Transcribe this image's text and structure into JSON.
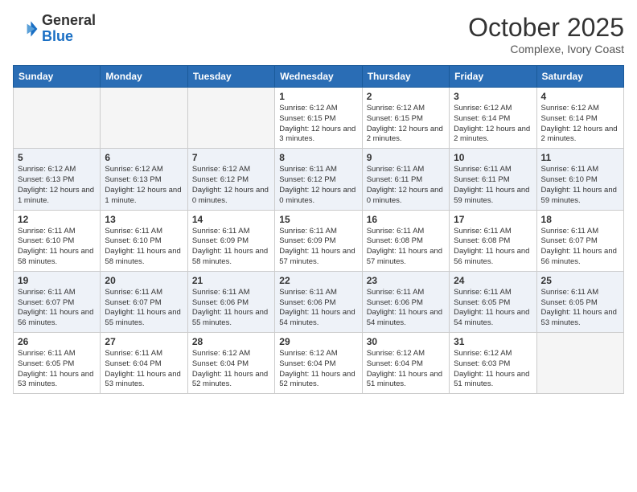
{
  "logo": {
    "general": "General",
    "blue": "Blue"
  },
  "header": {
    "month": "October 2025",
    "location": "Complexe, Ivory Coast"
  },
  "weekdays": [
    "Sunday",
    "Monday",
    "Tuesday",
    "Wednesday",
    "Thursday",
    "Friday",
    "Saturday"
  ],
  "weeks": [
    [
      {
        "day": "",
        "info": ""
      },
      {
        "day": "",
        "info": ""
      },
      {
        "day": "",
        "info": ""
      },
      {
        "day": "1",
        "info": "Sunrise: 6:12 AM\nSunset: 6:15 PM\nDaylight: 12 hours and 3 minutes."
      },
      {
        "day": "2",
        "info": "Sunrise: 6:12 AM\nSunset: 6:15 PM\nDaylight: 12 hours and 2 minutes."
      },
      {
        "day": "3",
        "info": "Sunrise: 6:12 AM\nSunset: 6:14 PM\nDaylight: 12 hours and 2 minutes."
      },
      {
        "day": "4",
        "info": "Sunrise: 6:12 AM\nSunset: 6:14 PM\nDaylight: 12 hours and 2 minutes."
      }
    ],
    [
      {
        "day": "5",
        "info": "Sunrise: 6:12 AM\nSunset: 6:13 PM\nDaylight: 12 hours and 1 minute."
      },
      {
        "day": "6",
        "info": "Sunrise: 6:12 AM\nSunset: 6:13 PM\nDaylight: 12 hours and 1 minute."
      },
      {
        "day": "7",
        "info": "Sunrise: 6:12 AM\nSunset: 6:12 PM\nDaylight: 12 hours and 0 minutes."
      },
      {
        "day": "8",
        "info": "Sunrise: 6:11 AM\nSunset: 6:12 PM\nDaylight: 12 hours and 0 minutes."
      },
      {
        "day": "9",
        "info": "Sunrise: 6:11 AM\nSunset: 6:11 PM\nDaylight: 12 hours and 0 minutes."
      },
      {
        "day": "10",
        "info": "Sunrise: 6:11 AM\nSunset: 6:11 PM\nDaylight: 11 hours and 59 minutes."
      },
      {
        "day": "11",
        "info": "Sunrise: 6:11 AM\nSunset: 6:10 PM\nDaylight: 11 hours and 59 minutes."
      }
    ],
    [
      {
        "day": "12",
        "info": "Sunrise: 6:11 AM\nSunset: 6:10 PM\nDaylight: 11 hours and 58 minutes."
      },
      {
        "day": "13",
        "info": "Sunrise: 6:11 AM\nSunset: 6:10 PM\nDaylight: 11 hours and 58 minutes."
      },
      {
        "day": "14",
        "info": "Sunrise: 6:11 AM\nSunset: 6:09 PM\nDaylight: 11 hours and 58 minutes."
      },
      {
        "day": "15",
        "info": "Sunrise: 6:11 AM\nSunset: 6:09 PM\nDaylight: 11 hours and 57 minutes."
      },
      {
        "day": "16",
        "info": "Sunrise: 6:11 AM\nSunset: 6:08 PM\nDaylight: 11 hours and 57 minutes."
      },
      {
        "day": "17",
        "info": "Sunrise: 6:11 AM\nSunset: 6:08 PM\nDaylight: 11 hours and 56 minutes."
      },
      {
        "day": "18",
        "info": "Sunrise: 6:11 AM\nSunset: 6:07 PM\nDaylight: 11 hours and 56 minutes."
      }
    ],
    [
      {
        "day": "19",
        "info": "Sunrise: 6:11 AM\nSunset: 6:07 PM\nDaylight: 11 hours and 56 minutes."
      },
      {
        "day": "20",
        "info": "Sunrise: 6:11 AM\nSunset: 6:07 PM\nDaylight: 11 hours and 55 minutes."
      },
      {
        "day": "21",
        "info": "Sunrise: 6:11 AM\nSunset: 6:06 PM\nDaylight: 11 hours and 55 minutes."
      },
      {
        "day": "22",
        "info": "Sunrise: 6:11 AM\nSunset: 6:06 PM\nDaylight: 11 hours and 54 minutes."
      },
      {
        "day": "23",
        "info": "Sunrise: 6:11 AM\nSunset: 6:06 PM\nDaylight: 11 hours and 54 minutes."
      },
      {
        "day": "24",
        "info": "Sunrise: 6:11 AM\nSunset: 6:05 PM\nDaylight: 11 hours and 54 minutes."
      },
      {
        "day": "25",
        "info": "Sunrise: 6:11 AM\nSunset: 6:05 PM\nDaylight: 11 hours and 53 minutes."
      }
    ],
    [
      {
        "day": "26",
        "info": "Sunrise: 6:11 AM\nSunset: 6:05 PM\nDaylight: 11 hours and 53 minutes."
      },
      {
        "day": "27",
        "info": "Sunrise: 6:11 AM\nSunset: 6:04 PM\nDaylight: 11 hours and 53 minutes."
      },
      {
        "day": "28",
        "info": "Sunrise: 6:12 AM\nSunset: 6:04 PM\nDaylight: 11 hours and 52 minutes."
      },
      {
        "day": "29",
        "info": "Sunrise: 6:12 AM\nSunset: 6:04 PM\nDaylight: 11 hours and 52 minutes."
      },
      {
        "day": "30",
        "info": "Sunrise: 6:12 AM\nSunset: 6:04 PM\nDaylight: 11 hours and 51 minutes."
      },
      {
        "day": "31",
        "info": "Sunrise: 6:12 AM\nSunset: 6:03 PM\nDaylight: 11 hours and 51 minutes."
      },
      {
        "day": "",
        "info": ""
      }
    ]
  ]
}
